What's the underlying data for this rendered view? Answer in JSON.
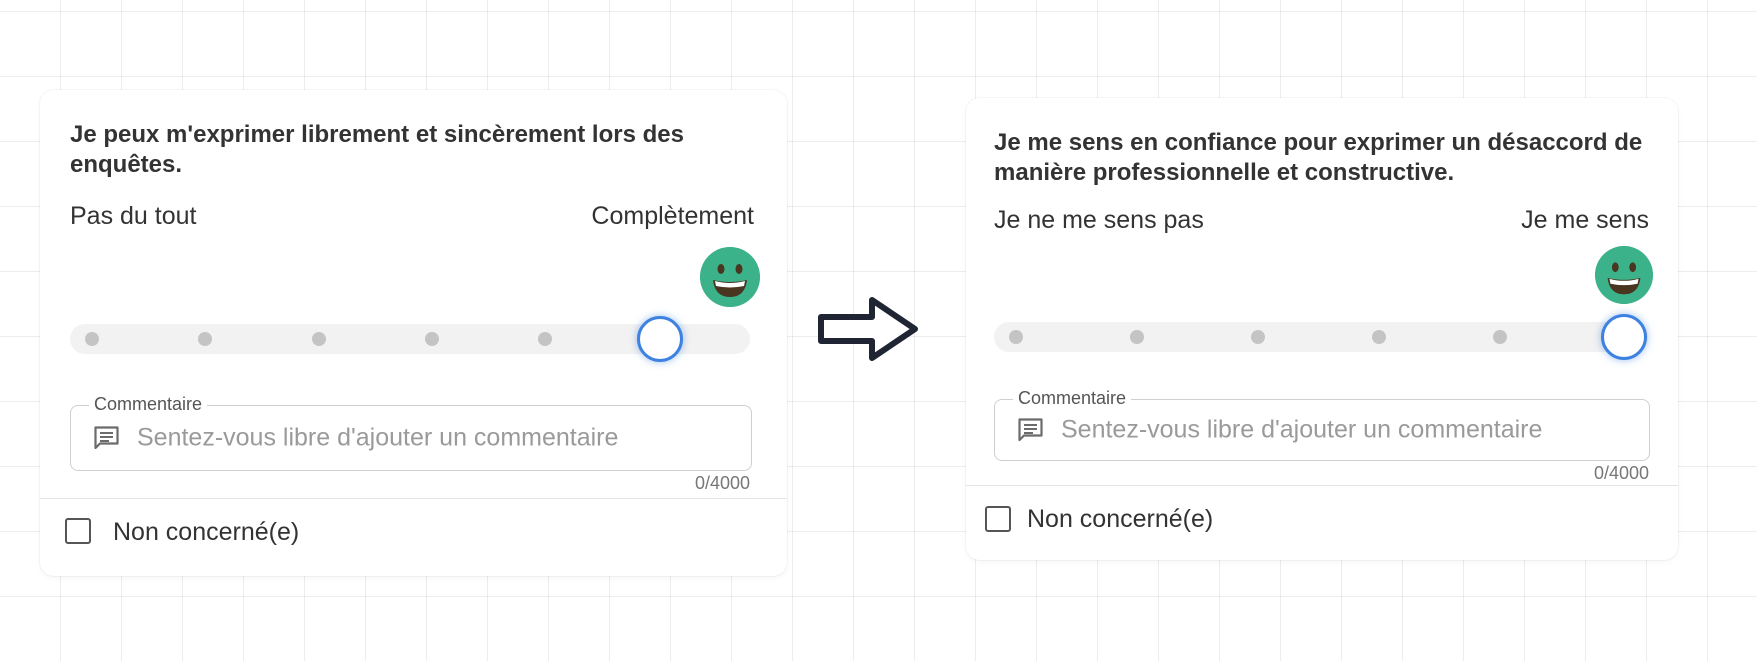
{
  "cards": [
    {
      "question": "Je peux m'exprimer librement et sincèrement lors des enquêtes.",
      "min_label": "Pas du tout",
      "max_label": "Complètement",
      "scale_steps": 6,
      "selected_step": 6,
      "comment_label": "Commentaire",
      "comment_placeholder": "Sentez-vous libre d'ajouter un commentaire",
      "counter": "0/4000",
      "not_concerned_label": "Non concerné(e)"
    },
    {
      "question": "Je me sens en confiance pour exprimer un désaccord de manière professionnelle et constructive.",
      "min_label": "Je ne me sens pas",
      "max_label": "Je me sens",
      "scale_steps": 6,
      "selected_step": 6,
      "comment_label": "Commentaire",
      "comment_placeholder": "Sentez-vous libre d'ajouter un commentaire",
      "counter": "0/4000",
      "not_concerned_label": "Non concerné(e)"
    }
  ],
  "icons": {
    "selected_emoji": "grinning-face-icon",
    "comment": "comment-icon",
    "transition": "arrow-right-icon"
  },
  "colors": {
    "emoji_face": "#3bb28a",
    "slider_thumb_border": "#3d82e0",
    "track": "#f2f2f2",
    "dot": "#c4c4c4"
  }
}
